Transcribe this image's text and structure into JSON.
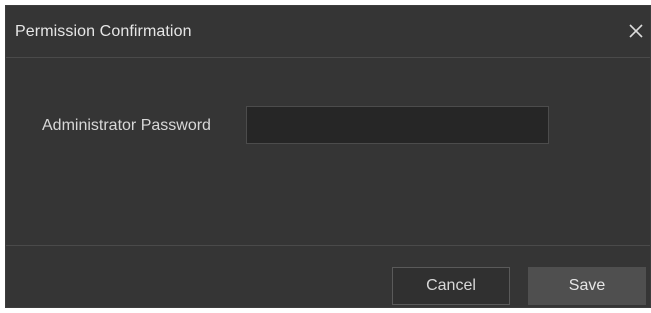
{
  "dialog": {
    "title": "Permission Confirmation",
    "close_icon": "close-icon"
  },
  "form": {
    "password_label": "Administrator Password",
    "password_value": "",
    "password_placeholder": ""
  },
  "footer": {
    "cancel_label": "Cancel",
    "save_label": "Save"
  },
  "colors": {
    "dialog_background": "#353535",
    "input_background": "#262626",
    "save_button_background": "#4f4f4f",
    "text": "#e6e6e6"
  }
}
